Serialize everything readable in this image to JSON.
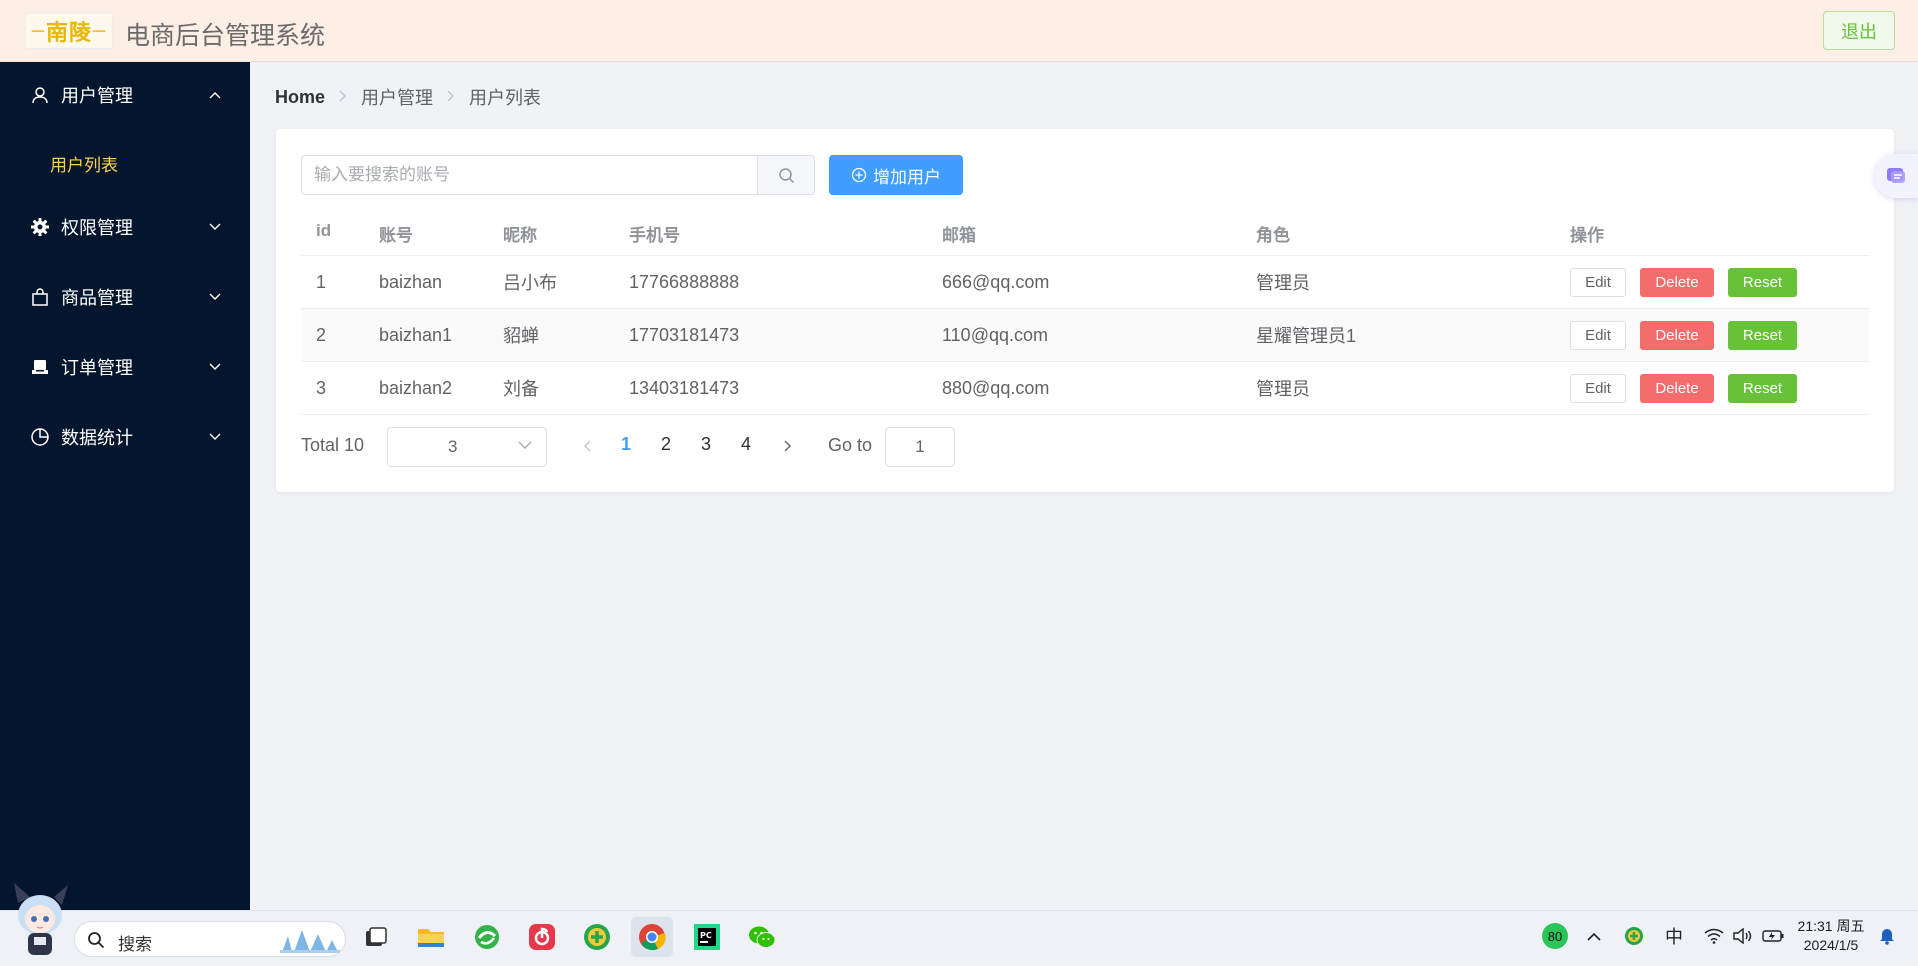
{
  "header": {
    "logo_text": "南陵",
    "title": "电商后台管理系统",
    "logout_label": "退出"
  },
  "sidebar": {
    "menus": [
      {
        "label": "用户管理",
        "icon": "user-icon",
        "expanded": true,
        "children": [
          {
            "label": "用户列表",
            "active": true
          }
        ]
      },
      {
        "label": "权限管理",
        "icon": "gear-icon",
        "expanded": false
      },
      {
        "label": "商品管理",
        "icon": "shopping-bag-icon",
        "expanded": false
      },
      {
        "label": "订单管理",
        "icon": "order-icon",
        "expanded": false
      },
      {
        "label": "数据统计",
        "icon": "pie-chart-icon",
        "expanded": false
      }
    ]
  },
  "breadcrumb": [
    "Home",
    "用户管理",
    "用户列表"
  ],
  "toolbar": {
    "search_placeholder": "输入要搜索的账号",
    "search_value": "",
    "add_user_label": "增加用户"
  },
  "table": {
    "columns": [
      "id",
      "账号",
      "昵称",
      "手机号",
      "邮箱",
      "角色",
      "操作"
    ],
    "rows": [
      {
        "id": "1",
        "account": "baizhan",
        "nickname": "吕小布",
        "phone": "17766888888",
        "email": "666@qq.com",
        "role": "管理员"
      },
      {
        "id": "2",
        "account": "baizhan1",
        "nickname": "貂蝉",
        "phone": "17703181473",
        "email": "110@qq.com",
        "role": "星耀管理员1"
      },
      {
        "id": "3",
        "account": "baizhan2",
        "nickname": "刘备",
        "phone": "13403181473",
        "email": "880@qq.com",
        "role": "管理员"
      }
    ],
    "actions": {
      "edit": "Edit",
      "delete": "Delete",
      "reset": "Reset"
    }
  },
  "pagination": {
    "total_label": "Total 10",
    "page_size": "3",
    "pages": [
      "1",
      "2",
      "3",
      "4"
    ],
    "current_page": "1",
    "goto_label": "Go to",
    "goto_value": "1"
  },
  "taskbar": {
    "search_label": "搜索",
    "apps": [
      "task-view",
      "file-explorer",
      "browser-360",
      "netease-music",
      "plus-app",
      "chrome",
      "pycharm",
      "wechat"
    ],
    "active_app": "chrome",
    "tray": {
      "badge_value": "80",
      "ime_label": "中",
      "time": "21:31 周五",
      "date": "2024/1/5"
    }
  },
  "colors": {
    "sidebar_bg": "#04162e",
    "active_menu": "#ffd04b",
    "primary": "#409eff",
    "danger": "#f56c6c",
    "success": "#67c23a",
    "header_bg": "#fdeee6"
  }
}
